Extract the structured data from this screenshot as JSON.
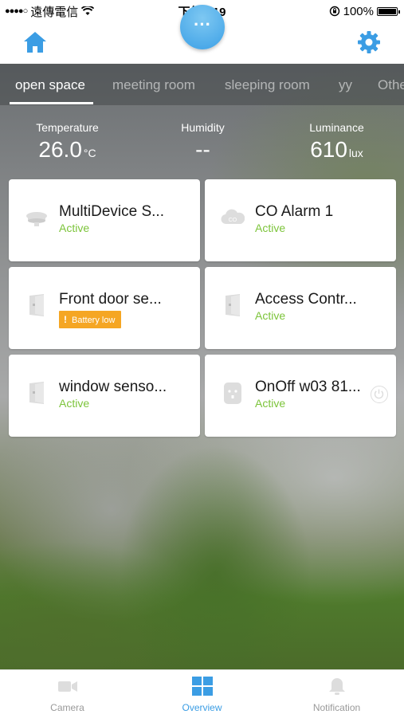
{
  "status_bar": {
    "carrier": "遠傳電信",
    "time": "下午3:19",
    "battery": "100%"
  },
  "header": {
    "home_icon": "home-icon",
    "center_button_label": "···",
    "settings_icon": "gear-icon"
  },
  "tabs": [
    {
      "label": "open space",
      "active": true
    },
    {
      "label": "meeting room",
      "active": false
    },
    {
      "label": "sleeping room",
      "active": false
    },
    {
      "label": "yy",
      "active": false
    },
    {
      "label": "Othe",
      "active": false
    }
  ],
  "sensors": {
    "temperature": {
      "label": "Temperature",
      "value": "26.0",
      "unit": "°C"
    },
    "humidity": {
      "label": "Humidity",
      "value": "--",
      "unit": ""
    },
    "luminance": {
      "label": "Luminance",
      "value": "610",
      "unit": "lux"
    }
  },
  "devices": [
    {
      "name": "MultiDevice S...",
      "status": "Active",
      "icon": "smoke-detector-icon"
    },
    {
      "name": "CO Alarm 1",
      "status": "Active",
      "icon": "co-alarm-icon"
    },
    {
      "name": "Front door se...",
      "status": "Battery low",
      "icon": "door-sensor-icon"
    },
    {
      "name": "Access Contr...",
      "status": "Active",
      "icon": "door-sensor-icon"
    },
    {
      "name": "window senso...",
      "status": "Active",
      "icon": "door-sensor-icon"
    },
    {
      "name": "OnOff w03 81...",
      "status": "Active",
      "icon": "smart-plug-icon"
    }
  ],
  "bottom_nav": [
    {
      "label": "Camera",
      "icon": "camera-icon",
      "active": false
    },
    {
      "label": "Overview",
      "icon": "grid-icon",
      "active": true
    },
    {
      "label": "Notification",
      "icon": "bell-icon",
      "active": false
    }
  ],
  "colors": {
    "accent": "#3b9de4",
    "active_status": "#7cc43a",
    "warning": "#f5a623"
  }
}
